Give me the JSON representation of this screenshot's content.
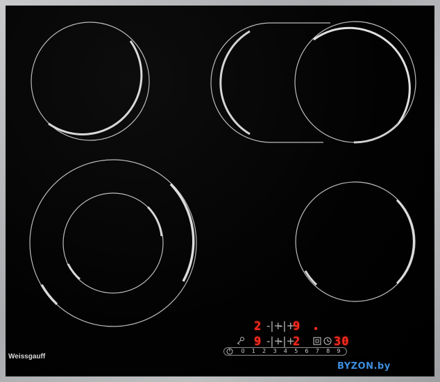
{
  "brand": {
    "name": "Weissgauff"
  },
  "watermark": {
    "text": "BYZON.by"
  },
  "zones": [
    {
      "name": "rear-left",
      "type": "single"
    },
    {
      "name": "rear-right",
      "type": "oval-extension"
    },
    {
      "name": "front-left",
      "type": "dual"
    },
    {
      "name": "front-right",
      "type": "single"
    }
  ],
  "controls": {
    "row1": {
      "left_level": "2",
      "right_level": "9",
      "plus_minus_left": "-|+",
      "plus_minus_right": "-|+"
    },
    "row2": {
      "left_level": "9",
      "right_level": "2",
      "plus_minus_left": "-|+",
      "plus_minus_right": "-|+"
    },
    "timer_display": "30",
    "slider_values": [
      "0",
      "1",
      "2",
      "3",
      "4",
      "5",
      "6",
      "7",
      "8",
      "9"
    ]
  },
  "colors": {
    "glass": "#000000",
    "frame": "#b3b4b6",
    "zone_ring": "#c8c8c8",
    "zone_highlight": "#e0e0e0",
    "led_red": "#ff2b1e",
    "watermark": "#3d8fe0"
  },
  "icons": [
    "key-lock-icon",
    "power-icon",
    "zone-select-icon",
    "timer-clock-icon",
    "indicator-dot-icon"
  ]
}
